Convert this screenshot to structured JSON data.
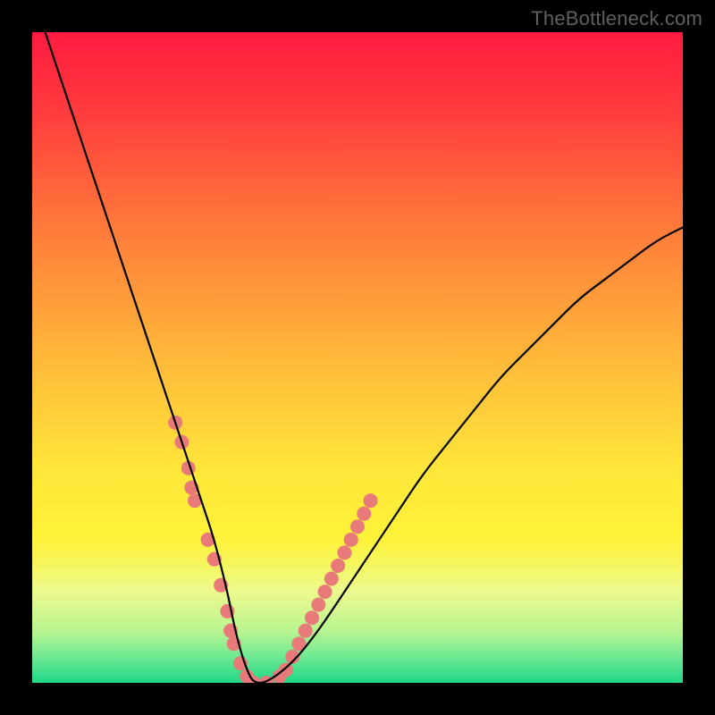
{
  "watermark": "TheBottleneck.com",
  "chart_data": {
    "type": "line",
    "title": "",
    "xlabel": "",
    "ylabel": "",
    "xlim": [
      0,
      100
    ],
    "ylim": [
      0,
      100
    ],
    "grid": false,
    "legend": false,
    "gradient_stops": [
      {
        "offset": 0,
        "color": "#ff1b3f"
      },
      {
        "offset": 0.12,
        "color": "#ff3b3e"
      },
      {
        "offset": 0.3,
        "color": "#ff7a3a"
      },
      {
        "offset": 0.5,
        "color": "#ffb83a"
      },
      {
        "offset": 0.68,
        "color": "#ffe83a"
      },
      {
        "offset": 0.78,
        "color": "#fff23a"
      },
      {
        "offset": 0.82,
        "color": "#f5f761"
      },
      {
        "offset": 0.86,
        "color": "#ecf98e"
      },
      {
        "offset": 0.92,
        "color": "#b9f590"
      },
      {
        "offset": 0.96,
        "color": "#6fe992"
      },
      {
        "offset": 1.0,
        "color": "#1fd789"
      }
    ],
    "curve": {
      "name": "bottleneck-curve",
      "color": "#000000",
      "x": [
        2,
        4,
        6,
        8,
        10,
        12,
        14,
        16,
        18,
        20,
        22,
        24,
        26,
        28,
        30,
        31,
        32,
        33,
        34,
        36,
        40,
        44,
        48,
        52,
        56,
        60,
        64,
        68,
        72,
        76,
        80,
        84,
        88,
        92,
        96,
        100
      ],
      "y": [
        100,
        94,
        88,
        82,
        76,
        70,
        64,
        58,
        52,
        46,
        40,
        34,
        28,
        22,
        14,
        9,
        5,
        2,
        0,
        0,
        3,
        8,
        14,
        20,
        26,
        32,
        37,
        42,
        47,
        51,
        55,
        59,
        62,
        65,
        68,
        70
      ]
    },
    "markers": {
      "name": "highlight-dots",
      "color": "#e97a7a",
      "radius": 8,
      "points": [
        {
          "x": 22,
          "y": 40
        },
        {
          "x": 23,
          "y": 37
        },
        {
          "x": 24,
          "y": 33
        },
        {
          "x": 24.5,
          "y": 30
        },
        {
          "x": 25,
          "y": 28
        },
        {
          "x": 27,
          "y": 22
        },
        {
          "x": 28,
          "y": 19
        },
        {
          "x": 29,
          "y": 15
        },
        {
          "x": 30,
          "y": 11
        },
        {
          "x": 30.5,
          "y": 8
        },
        {
          "x": 31,
          "y": 6
        },
        {
          "x": 32,
          "y": 3
        },
        {
          "x": 33,
          "y": 1
        },
        {
          "x": 34,
          "y": 0
        },
        {
          "x": 36,
          "y": 0
        },
        {
          "x": 38,
          "y": 1
        },
        {
          "x": 39,
          "y": 2
        },
        {
          "x": 40,
          "y": 4
        },
        {
          "x": 41,
          "y": 6
        },
        {
          "x": 42,
          "y": 8
        },
        {
          "x": 43,
          "y": 10
        },
        {
          "x": 44,
          "y": 12
        },
        {
          "x": 45,
          "y": 14
        },
        {
          "x": 46,
          "y": 16
        },
        {
          "x": 47,
          "y": 18
        },
        {
          "x": 48,
          "y": 20
        },
        {
          "x": 49,
          "y": 22
        },
        {
          "x": 50,
          "y": 24
        },
        {
          "x": 51,
          "y": 26
        },
        {
          "x": 52,
          "y": 28
        }
      ]
    }
  }
}
